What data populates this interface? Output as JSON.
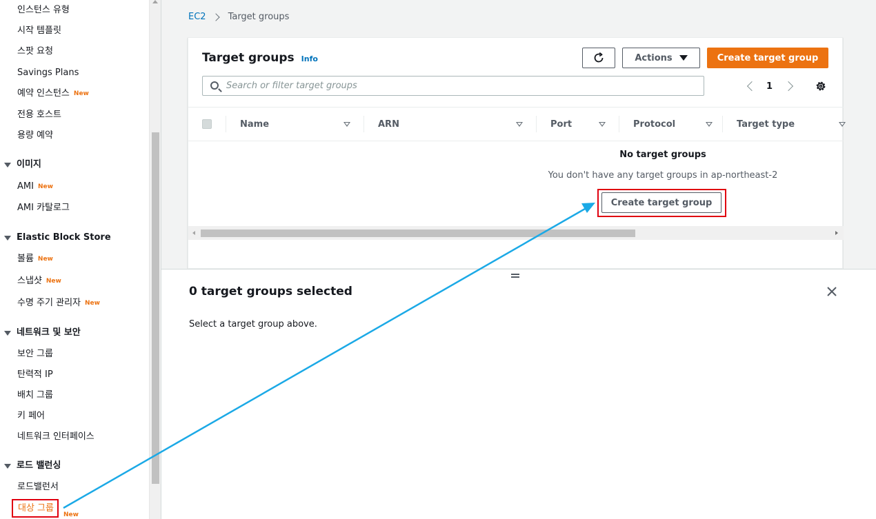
{
  "sidebar": {
    "items_top": [
      {
        "label": "인스턴스 유형",
        "new": ""
      },
      {
        "label": "시작 템플릿",
        "new": ""
      },
      {
        "label": "스팟 요청",
        "new": ""
      },
      {
        "label": "Savings Plans",
        "new": ""
      },
      {
        "label": "예약 인스턴스",
        "new": "New"
      },
      {
        "label": "전용 호스트",
        "new": ""
      },
      {
        "label": "용량 예약",
        "new": ""
      }
    ],
    "section_images": "이미지",
    "images_items": [
      {
        "label": "AMI",
        "new": "New"
      },
      {
        "label": "AMI 카탈로그",
        "new": ""
      }
    ],
    "section_ebs": "Elastic Block Store",
    "ebs_items": [
      {
        "label": "볼륨",
        "new": "New"
      },
      {
        "label": "스냅샷",
        "new": "New"
      },
      {
        "label": "수명 주기 관리자",
        "new": "New"
      }
    ],
    "section_network": "네트워크 및 보안",
    "network_items": [
      {
        "label": "보안 그룹",
        "new": ""
      },
      {
        "label": "탄력적 IP",
        "new": ""
      },
      {
        "label": "배치 그룹",
        "new": ""
      },
      {
        "label": "키 페어",
        "new": ""
      },
      {
        "label": "네트워크 인터페이스",
        "new": ""
      }
    ],
    "section_lb": "로드 밸런싱",
    "lb_items": [
      {
        "label": "로드밸런서",
        "new": ""
      }
    ],
    "active_item": {
      "label": "대상 그룹",
      "new": "New"
    }
  },
  "breadcrumb": {
    "root": "EC2",
    "current": "Target groups"
  },
  "panel": {
    "title": "Target groups",
    "info": "Info",
    "actions_label": "Actions",
    "create_label": "Create target group",
    "search_placeholder": "Search or filter target groups",
    "page": "1"
  },
  "table": {
    "columns": [
      "Name",
      "ARN",
      "Port",
      "Protocol",
      "Target type"
    ],
    "empty_title": "No target groups",
    "empty_message": "You don't have any target groups in ap-northeast-2",
    "empty_button": "Create target group"
  },
  "details": {
    "title": "0 target groups selected",
    "message": "Select a target group above."
  },
  "colors": {
    "accent": "#ec7211",
    "link": "#0073bb",
    "highlight": "#e0000f",
    "arrow": "#1ba9e6"
  }
}
